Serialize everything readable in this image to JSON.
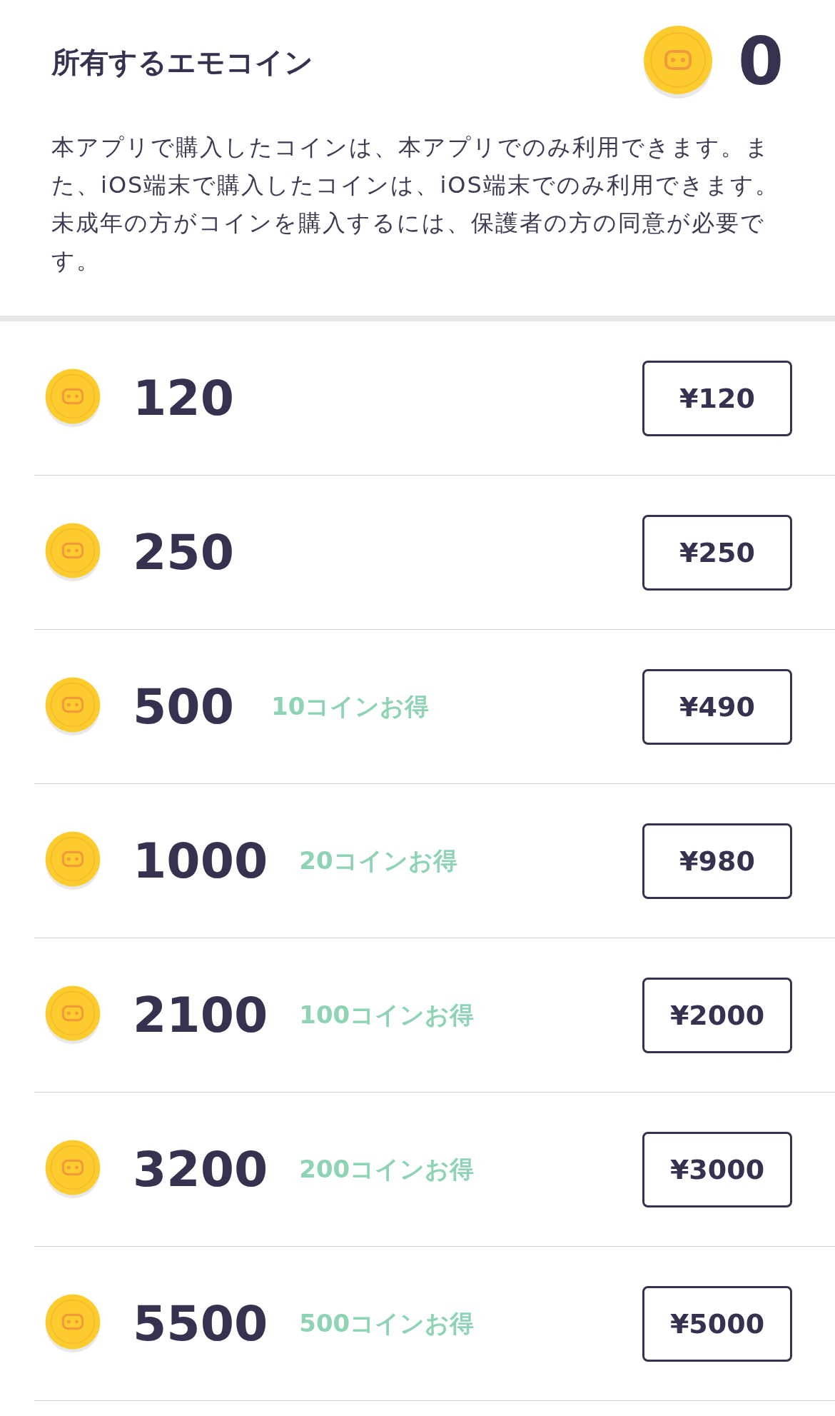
{
  "header": {
    "title": "所有するエモコイン",
    "balance": "0",
    "notice": "本アプリで購入したコインは、本アプリでのみ利用できます。また、iOS端末で購入したコインは、iOS端末でのみ利用できます。未成年の方がコインを購入するには、保護者の方の同意が必要です。"
  },
  "packages": [
    {
      "coins": "120",
      "price": "¥120"
    },
    {
      "coins": "250",
      "price": "¥250"
    },
    {
      "coins": "500",
      "bonus": "10コインお得",
      "price": "¥490"
    },
    {
      "coins": "1000",
      "bonus": "20コインお得",
      "price": "¥980"
    },
    {
      "coins": "2100",
      "bonus": "100コインお得",
      "price": "¥2000"
    },
    {
      "coins": "3200",
      "bonus": "200コインお得",
      "price": "¥3000"
    },
    {
      "coins": "5500",
      "bonus": "500コインお得",
      "price": "¥5000"
    }
  ]
}
